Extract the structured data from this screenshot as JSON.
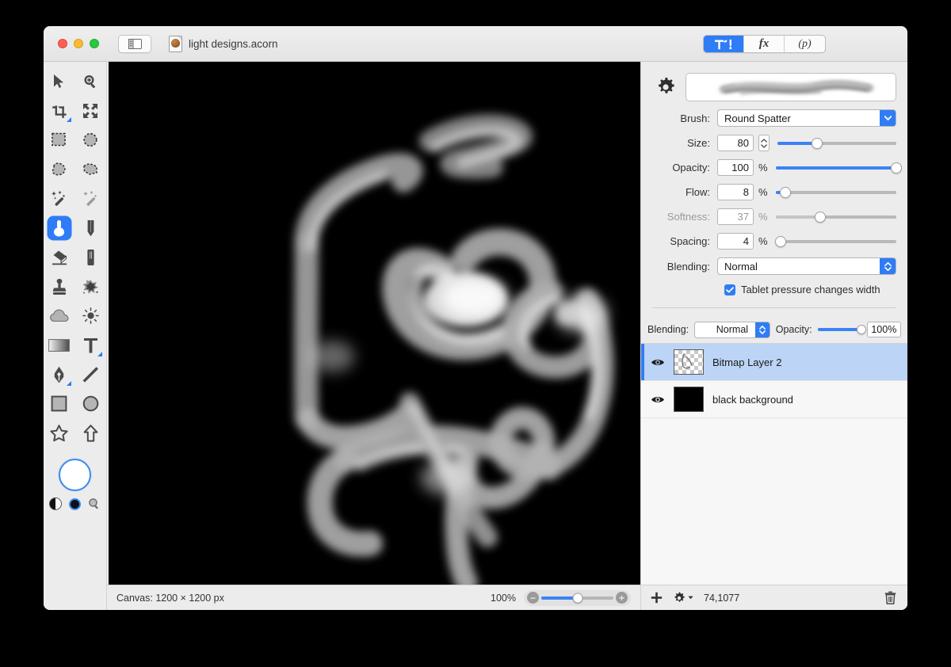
{
  "window": {
    "title": "light designs.acorn",
    "doc_icon": "acorn-document-icon",
    "traffic_lights": [
      "close",
      "minimize",
      "zoom"
    ],
    "sidebar_toggle_icon": "sidebar-toggle-icon"
  },
  "inspector_tabs": [
    {
      "id": "tools",
      "label": "",
      "icon": "tools-hammer-pen-icon",
      "active": true
    },
    {
      "id": "filters",
      "label": "fx",
      "icon": "fx-icon",
      "active": false
    },
    {
      "id": "palette",
      "label": "(p)",
      "icon": "palette-icon",
      "active": false
    }
  ],
  "toolbar": {
    "rows": [
      [
        {
          "name": "move-tool",
          "icon": "arrow-cursor-icon",
          "selected": false,
          "corner": false
        },
        {
          "name": "zoom-tool",
          "icon": "magnifier-plus-icon",
          "selected": false,
          "corner": false
        }
      ],
      [
        {
          "name": "crop-tool",
          "icon": "crop-icon",
          "selected": false,
          "corner": true
        },
        {
          "name": "transform-tool",
          "icon": "move-arrows-icon",
          "selected": false,
          "corner": false
        }
      ],
      [
        {
          "name": "rectangle-select-tool",
          "icon": "rect-marquee-icon",
          "selected": false,
          "corner": false
        },
        {
          "name": "ellipse-select-tool",
          "icon": "ellipse-marquee-icon",
          "selected": false,
          "corner": false
        }
      ],
      [
        {
          "name": "lasso-tool",
          "icon": "lasso-icon",
          "selected": false,
          "corner": false
        },
        {
          "name": "polygon-lasso-tool",
          "icon": "polygon-lasso-icon",
          "selected": false,
          "corner": false
        }
      ],
      [
        {
          "name": "magic-wand-tool",
          "icon": "magic-wand-icon",
          "selected": false,
          "corner": false
        },
        {
          "name": "instant-alpha-tool",
          "icon": "dotted-wand-icon",
          "selected": false,
          "corner": false
        }
      ],
      [
        {
          "name": "brush-tool",
          "icon": "paintbrush-icon",
          "selected": true,
          "corner": false
        },
        {
          "name": "pencil-tool",
          "icon": "pencil-icon",
          "selected": false,
          "corner": false
        }
      ],
      [
        {
          "name": "eraser-tool",
          "icon": "eraser-icon",
          "selected": false,
          "corner": false
        },
        {
          "name": "marker-tool",
          "icon": "marker-icon",
          "selected": false,
          "corner": false
        }
      ],
      [
        {
          "name": "clone-stamp-tool",
          "icon": "clone-stamp-icon",
          "selected": false,
          "corner": false
        },
        {
          "name": "smudge-tool",
          "icon": "smudge-splat-icon",
          "selected": false,
          "corner": false
        }
      ],
      [
        {
          "name": "blur-tool",
          "icon": "cloud-icon",
          "selected": false,
          "corner": false
        },
        {
          "name": "dodge-tool",
          "icon": "sun-icon",
          "selected": false,
          "corner": false
        }
      ],
      [
        {
          "name": "gradient-tool",
          "icon": "gradient-icon",
          "selected": false,
          "corner": false
        },
        {
          "name": "text-tool",
          "icon": "text-t-icon",
          "selected": false,
          "corner": true
        }
      ],
      [
        {
          "name": "bezier-pen-tool",
          "icon": "pen-nib-icon",
          "selected": false,
          "corner": true
        },
        {
          "name": "line-tool",
          "icon": "line-icon",
          "selected": false,
          "corner": false
        }
      ],
      [
        {
          "name": "rectangle-shape-tool",
          "icon": "square-icon",
          "selected": false,
          "corner": false
        },
        {
          "name": "ellipse-shape-tool",
          "icon": "circle-icon",
          "selected": false,
          "corner": false
        }
      ],
      [
        {
          "name": "star-shape-tool",
          "icon": "star-icon",
          "selected": false,
          "corner": false
        },
        {
          "name": "arrow-shape-tool",
          "icon": "arrow-up-icon",
          "selected": false,
          "corner": false
        }
      ]
    ],
    "foreground_color": "#ffffff",
    "background_color": "#000000",
    "swap_icon": "yin-yang-swap-icon",
    "color_picker_icon": "magnifier-icon"
  },
  "brush_panel": {
    "gear_icon": "gear-icon",
    "preview_label": "brush-stroke-preview",
    "brush": {
      "label": "Brush:",
      "value": "Round Spatter"
    },
    "size": {
      "label": "Size:",
      "value": "80",
      "slider_pct": 33,
      "enabled": true
    },
    "opacity": {
      "label": "Opacity:",
      "value": "100",
      "unit": "%",
      "slider_pct": 100,
      "enabled": true
    },
    "flow": {
      "label": "Flow:",
      "value": "8",
      "unit": "%",
      "slider_pct": 8,
      "enabled": true
    },
    "softness": {
      "label": "Softness:",
      "value": "37",
      "unit": "%",
      "slider_pct": 37,
      "enabled": false
    },
    "spacing": {
      "label": "Spacing:",
      "value": "4",
      "unit": "%",
      "slider_pct": 4,
      "enabled": true
    },
    "blending": {
      "label": "Blending:",
      "value": "Normal"
    },
    "tablet_pressure": {
      "label": "Tablet pressure changes width",
      "checked": true
    }
  },
  "layers_panel": {
    "blending_label": "Blending:",
    "blending_value": "Normal",
    "opacity_label": "Opacity:",
    "opacity_value": "100%",
    "opacity_pct": 100,
    "layers": [
      {
        "name": "Bitmap Layer 2",
        "visible": true,
        "selected": true,
        "thumb": "transparent-checker"
      },
      {
        "name": "black background",
        "visible": true,
        "selected": false,
        "thumb": "solid-black"
      }
    ],
    "footer": {
      "add_icon": "plus-icon",
      "settings_icon": "gear-dropdown-icon",
      "coordinates": "74,1077",
      "delete_icon": "trash-icon"
    }
  },
  "statusbar": {
    "canvas_info": "Canvas: 1200 × 1200 px",
    "zoom_level": "100%",
    "zoom_slider_pct": 50,
    "zoom_out_icon": "minus-circle-icon",
    "zoom_in_icon": "plus-circle-icon"
  },
  "colors": {
    "accent": "#2f7cf6",
    "slider_blue": "#3b82f6",
    "selection_row": "#bcd4f5",
    "panel_bg": "#ececec",
    "canvas_bg": "#000000"
  }
}
